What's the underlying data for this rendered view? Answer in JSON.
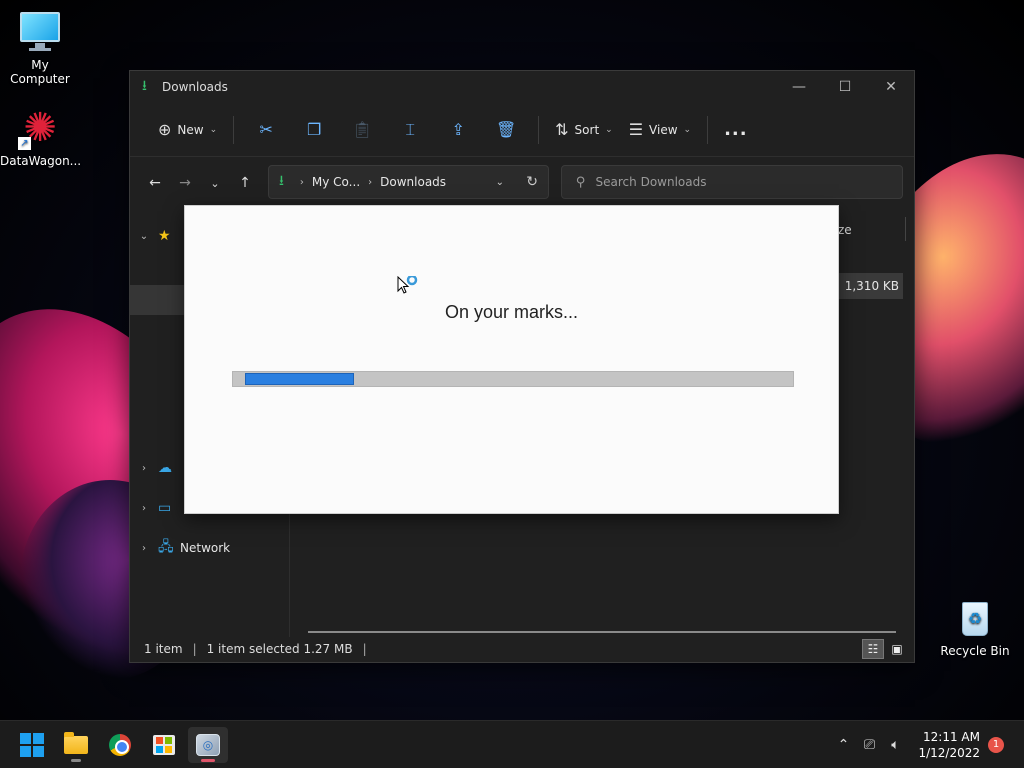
{
  "desktop": {
    "icons": [
      {
        "label": "My Computer"
      },
      {
        "label": "DataWagon..."
      },
      {
        "label": "Recycle Bin"
      }
    ]
  },
  "explorer": {
    "title": "Downloads",
    "toolbar": {
      "new_label": "New",
      "sort_label": "Sort",
      "view_label": "View",
      "more_label": "..."
    },
    "address": {
      "crumbs": [
        "My Co...",
        "Downloads"
      ]
    },
    "search": {
      "placeholder": "Search Downloads"
    },
    "sidebar": {
      "items": [
        {
          "label": "Network"
        }
      ]
    },
    "columns": {
      "size_partial": "ze"
    },
    "files": [
      {
        "size": "1,310 KB"
      }
    ],
    "status": {
      "count": "1 item",
      "selected": "1 item selected  1.27 MB"
    }
  },
  "installer": {
    "message": "On your marks...",
    "progress": 0.2
  },
  "taskbar": {
    "time": "12:11 AM",
    "date": "1/12/2022",
    "notification_count": "1"
  },
  "colors": {
    "accent": "#2a7fe0",
    "download_green": "#36c06d",
    "taskbar": "#1c1c1c"
  }
}
